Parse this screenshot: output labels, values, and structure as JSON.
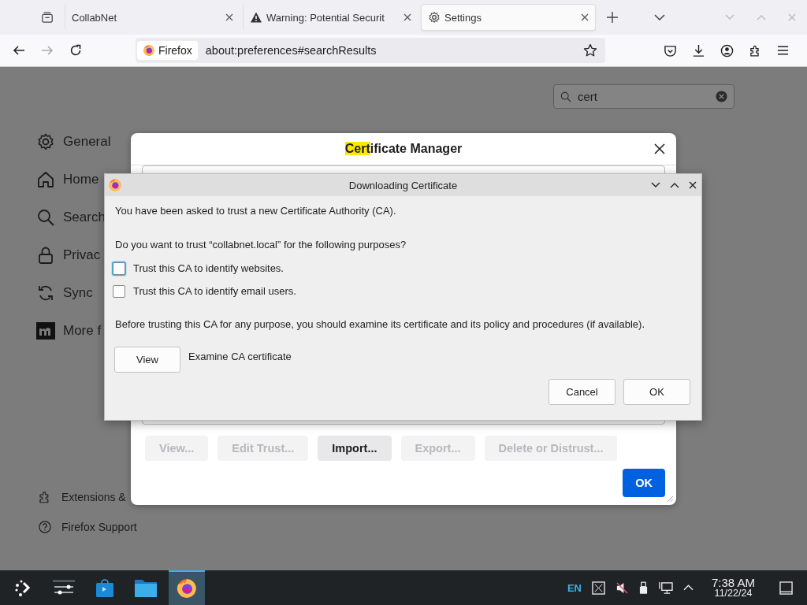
{
  "browser": {
    "tabs": [
      {
        "title": "CollabNet",
        "kind": "plain",
        "selected": false
      },
      {
        "title": "Warning: Potential Securit",
        "kind": "warning",
        "selected": false
      },
      {
        "title": "Settings",
        "kind": "settings",
        "selected": true
      }
    ],
    "identity": "Firefox",
    "url": "about:preferences#searchResults"
  },
  "settings": {
    "search": {
      "value": "cert"
    },
    "nav_items": [
      {
        "label": "General"
      },
      {
        "label": "Home"
      },
      {
        "label": "Search"
      },
      {
        "label": "Privac"
      },
      {
        "label": "Sync"
      },
      {
        "label": "More f"
      }
    ],
    "footer_links": [
      {
        "label": "Extensions &"
      },
      {
        "label": "Firefox Support"
      }
    ]
  },
  "certificate_manager": {
    "title_match": "Cert",
    "title_rest": "ificate Manager",
    "buttons": [
      {
        "label": "View...",
        "disabled": true
      },
      {
        "label": "Edit Trust...",
        "disabled": true
      },
      {
        "label": "Import...",
        "disabled": false
      },
      {
        "label": "Export...",
        "disabled": true
      },
      {
        "label": "Delete or Distrust...",
        "disabled": true
      }
    ],
    "ok": "OK"
  },
  "dialog": {
    "title": "Downloading Certificate",
    "intro": "You have been asked to trust a new Certificate Authority (CA).",
    "question": "Do you want to trust “collabnet.local” for the following purposes?",
    "options": [
      {
        "label": "Trust this CA to identify websites.",
        "checked": false,
        "focused": true
      },
      {
        "label": "Trust this CA to identify email users.",
        "checked": false,
        "focused": false
      }
    ],
    "advice": "Before trusting this CA for any purpose, you should examine its certificate and its policy and procedures (if available).",
    "view_button": "View",
    "view_label": "Examine CA certificate",
    "buttons": [
      "Cancel",
      "OK"
    ]
  },
  "taskbar": {
    "apps": [
      {
        "kind": "launcher",
        "active": false
      },
      {
        "kind": "settings",
        "active": false
      },
      {
        "kind": "store",
        "active": false
      },
      {
        "kind": "files",
        "active": false
      },
      {
        "kind": "firefox",
        "active": true
      }
    ],
    "language": "EN",
    "time": "7:38 AM",
    "date": "11/22/24"
  }
}
